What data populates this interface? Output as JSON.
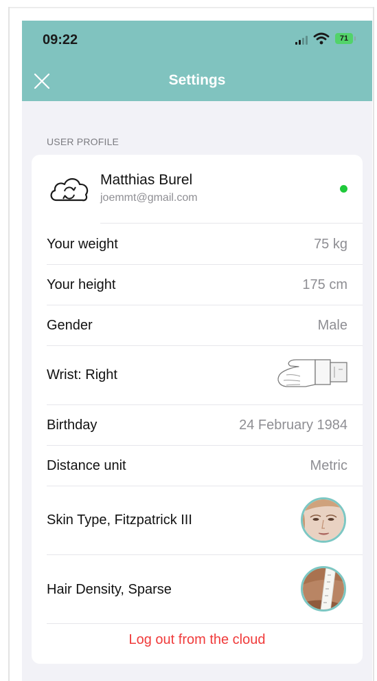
{
  "status_bar": {
    "time": "09:22",
    "battery": "71",
    "signal_icon": "cellular-signal-icon",
    "wifi_icon": "wifi-icon",
    "battery_icon": "battery-charging-icon"
  },
  "header": {
    "title": "Settings",
    "close_icon": "close-icon",
    "background_color": "#80c3bf"
  },
  "section": {
    "label": "USER PROFILE"
  },
  "profile": {
    "name": "Matthias Burel",
    "email": "joemmt@gmail.com",
    "cloud_icon": "cloud-sync-icon",
    "status_color": "#1fc93a"
  },
  "rows": [
    {
      "label": "Your weight",
      "value": "75 kg"
    },
    {
      "label": "Your height",
      "value": "175 cm"
    },
    {
      "label": "Gender",
      "value": "Male"
    },
    {
      "label": "Wrist: Right",
      "icon": "wrist-watch-icon"
    },
    {
      "label": "Birthday",
      "value": "24 February 1984"
    },
    {
      "label": "Distance unit",
      "value": "Metric"
    },
    {
      "label": "Skin Type, Fitzpatrick III",
      "icon": "skin-type-face-icon"
    },
    {
      "label": "Hair Density, Sparse",
      "icon": "hair-density-arm-icon"
    }
  ],
  "logout": {
    "label": "Log out from the cloud",
    "color": "#f03a3a"
  }
}
